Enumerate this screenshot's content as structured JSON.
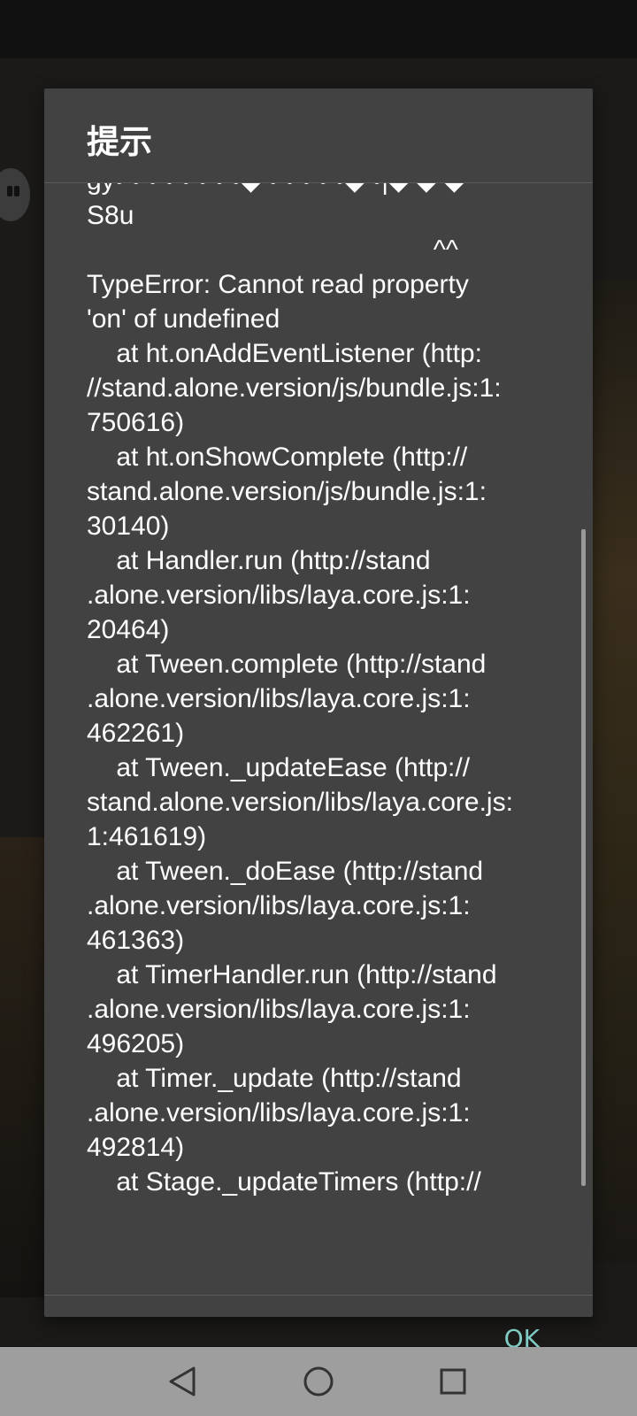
{
  "dialog": {
    "title": "提示",
    "message_lines": [
      "gy• • • • • • • •◆ • • • • •◆ •|◆ ◆ ◆",
      "S8u",
      "                                               ^^",
      "TypeError: Cannot read property",
      "'on' of undefined",
      "    at ht.onAddEventListener (http:",
      "//stand.alone.version/js/bundle.js:1:",
      "750616)",
      "    at ht.onShowComplete (http://",
      "stand.alone.version/js/bundle.js:1:",
      "30140)",
      "    at Handler.run (http://stand",
      ".alone.version/libs/laya.core.js:1:",
      "20464)",
      "    at Tween.complete (http://stand",
      ".alone.version/libs/laya.core.js:1:",
      "462261)",
      "    at Tween._updateEase (http://",
      "stand.alone.version/libs/laya.core.js:",
      "1:461619)",
      "    at Tween._doEase (http://stand",
      ".alone.version/libs/laya.core.js:1:",
      "461363)",
      "    at TimerHandler.run (http://stand",
      ".alone.version/libs/laya.core.js:1:",
      "496205)",
      "    at Timer._update (http://stand",
      ".alone.version/libs/laya.core.js:1:",
      "492814)",
      "    at Stage._updateTimers (http://"
    ],
    "ok_label": "OK"
  },
  "navbar": {
    "back_icon": "back-triangle",
    "home_icon": "home-circle",
    "recents_icon": "recents-square"
  },
  "colors": {
    "dialog_bg": "#424242",
    "accent": "#80cbc4",
    "navbar_bg": "#9e9e9e"
  }
}
